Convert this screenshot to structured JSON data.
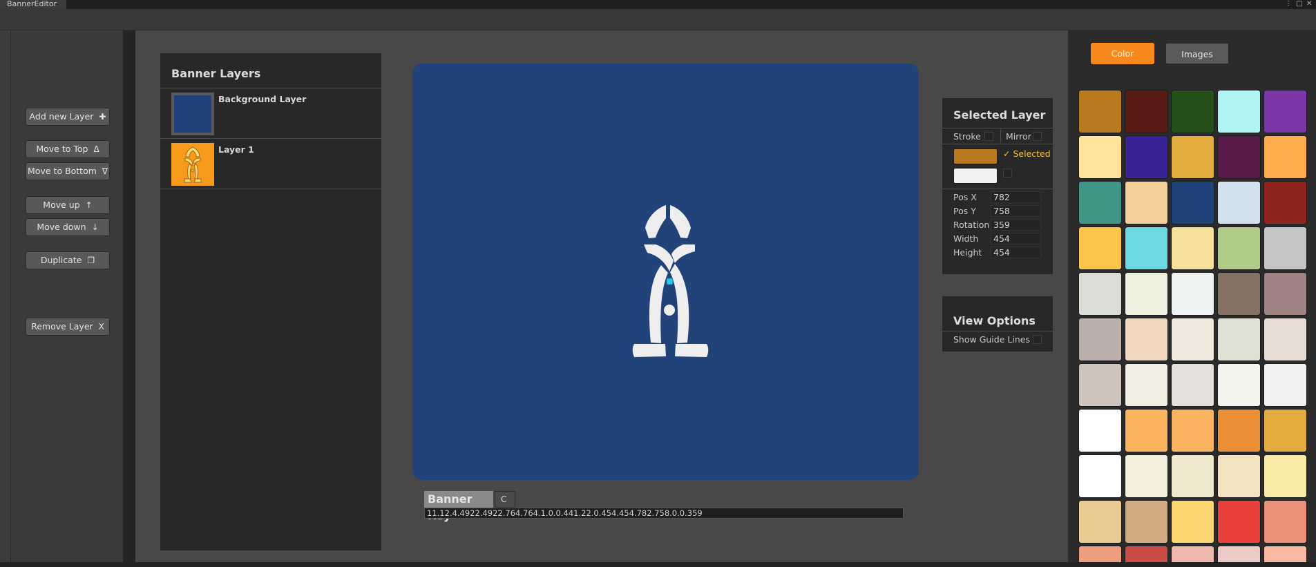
{
  "window": {
    "title": "BannerEditor",
    "controls": [
      "⋮",
      "□",
      "✕"
    ]
  },
  "tools": [
    {
      "label": "Add new Layer",
      "icon": "✚",
      "name": "add-new-layer-button",
      "icon_name": "plus-icon"
    },
    {
      "label": "Move to Top",
      "icon": "Δ",
      "name": "move-to-top-button",
      "icon_name": "triangle-up-icon"
    },
    {
      "label": "Move to Bottom",
      "icon": "∇",
      "name": "move-to-bottom-button",
      "icon_name": "triangle-down-icon"
    },
    {
      "label": "Move up",
      "icon": "↑",
      "name": "move-up-button",
      "icon_name": "arrow-up-icon"
    },
    {
      "label": "Move down",
      "icon": "↓",
      "name": "move-down-button",
      "icon_name": "arrow-down-icon"
    },
    {
      "label": "Duplicate",
      "icon": "❐",
      "name": "duplicate-button",
      "icon_name": "duplicate-icon"
    },
    {
      "label": "Remove Layer",
      "icon": "X",
      "name": "remove-layer-button",
      "icon_name": "close-icon"
    }
  ],
  "layers": {
    "title": "Banner Layers",
    "items": [
      {
        "name": "Background Layer",
        "thumb_color": "#22427a"
      },
      {
        "name": "Layer 1",
        "thumb_color": "#f89a1c"
      }
    ]
  },
  "canvas": {
    "background": "#22427a",
    "emblem_color": "#eeeeee",
    "handle_color": "#2ec6e6"
  },
  "banner_key": {
    "label": "Banner Key",
    "copy_label": "C",
    "value": "11.12.4.4922.4922.764.764.1.0.0.441.22.0.454.454.782.758.0.0.359"
  },
  "selected_layer": {
    "title": "Selected Layer",
    "stroke_label": "Stroke",
    "mirror_label": "Mirror",
    "primary_color": "#b8791f",
    "secondary_color": "#f2f2f2",
    "selected_label": "Selected",
    "props": [
      {
        "label": "Pos X",
        "value": "782"
      },
      {
        "label": "Pos Y",
        "value": "758"
      },
      {
        "label": "Rotation",
        "value": "359"
      },
      {
        "label": "Width",
        "value": "454"
      },
      {
        "label": "Height",
        "value": "454"
      }
    ]
  },
  "view_options": {
    "title": "View Options",
    "show_guide_lines_label": "Show Guide Lines"
  },
  "color_panel": {
    "tabs": [
      {
        "label": "Color",
        "active": true,
        "bg": "#f7891f"
      },
      {
        "label": "Images",
        "active": false,
        "bg": "#5a5a5a"
      }
    ],
    "swatches": [
      "#b8791f",
      "#5a1a16",
      "#24501a",
      "#b2f4f2",
      "#7b36a8",
      "#fde49a",
      "#3a2394",
      "#e3ac40",
      "#581a48",
      "#fdac4e",
      "#3f9586",
      "#f5cf98",
      "#22427a",
      "#d3e0ed",
      "#8e241d",
      "#fcc64c",
      "#6ad9e3",
      "#f5e19a",
      "#b0cb86",
      "#c5c5c5",
      "#dcdcd6",
      "#eef1df",
      "#f0f3f3",
      "#867264",
      "#9f8483",
      "#bcaea8",
      "#eed7be",
      "#f1e8de",
      "#e0e1d2",
      "#e8ddd5",
      "#cfc4bc",
      "#f1efe2",
      "#e4e1dc",
      "#f4f3ec",
      "#f0f3ef",
      "#ffffff",
      "#fdb45e",
      "#fdb460",
      "#ea8f36",
      "#e3ac40",
      "#ffffff",
      "#f4eedc",
      "#efe8cc",
      "#f1e2c0",
      "#faeaa8",
      "#e9cb94",
      "#d3aa80",
      "#fcd771",
      "#e8423a",
      "#ec927a",
      "#ee9d80",
      "#cb4b47",
      "#efb8ad",
      "#ecc9c5",
      "#fbb9a4"
    ]
  }
}
